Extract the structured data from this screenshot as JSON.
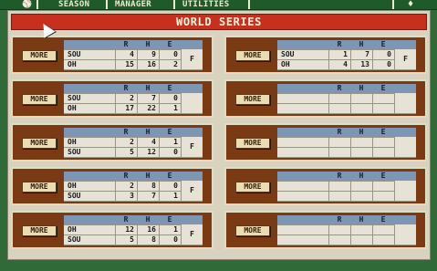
{
  "menubar": {
    "items": [
      "SEASON",
      "MANAGER",
      "UTILITIES"
    ]
  },
  "title": "WORLD SERIES",
  "more_label": "MORE",
  "headers": {
    "r": "R",
    "h": "H",
    "e": "E"
  },
  "games": [
    {
      "away": {
        "team": "SOU",
        "r": "4",
        "h": "9",
        "e": "0"
      },
      "home": {
        "team": "OH",
        "r": "15",
        "h": "16",
        "e": "2"
      },
      "status": "F"
    },
    {
      "away": {
        "team": "SOU",
        "r": "2",
        "h": "7",
        "e": "0"
      },
      "home": {
        "team": "OH",
        "r": "17",
        "h": "22",
        "e": "1"
      },
      "status": ""
    },
    {
      "away": {
        "team": "OH",
        "r": "2",
        "h": "4",
        "e": "1"
      },
      "home": {
        "team": "SOU",
        "r": "5",
        "h": "12",
        "e": "0"
      },
      "status": "F"
    },
    {
      "away": {
        "team": "OH",
        "r": "2",
        "h": "8",
        "e": "0"
      },
      "home": {
        "team": "SOU",
        "r": "3",
        "h": "7",
        "e": "1"
      },
      "status": "F"
    },
    {
      "away": {
        "team": "OH",
        "r": "12",
        "h": "16",
        "e": "1"
      },
      "home": {
        "team": "SOU",
        "r": "5",
        "h": "8",
        "e": "0"
      },
      "status": "F"
    },
    {
      "away": {
        "team": "SOU",
        "r": "1",
        "h": "7",
        "e": "0"
      },
      "home": {
        "team": "OH",
        "r": "4",
        "h": "13",
        "e": "0"
      },
      "status": "F"
    },
    {
      "away": {
        "team": "",
        "r": "",
        "h": "",
        "e": ""
      },
      "home": {
        "team": "",
        "r": "",
        "h": "",
        "e": ""
      },
      "status": ""
    },
    {
      "away": {
        "team": "",
        "r": "",
        "h": "",
        "e": ""
      },
      "home": {
        "team": "",
        "r": "",
        "h": "",
        "e": ""
      },
      "status": ""
    },
    {
      "away": {
        "team": "",
        "r": "",
        "h": "",
        "e": ""
      },
      "home": {
        "team": "",
        "r": "",
        "h": "",
        "e": ""
      },
      "status": ""
    },
    {
      "away": {
        "team": "",
        "r": "",
        "h": "",
        "e": ""
      },
      "home": {
        "team": "",
        "r": "",
        "h": "",
        "e": ""
      },
      "status": ""
    }
  ],
  "colors": {
    "background": "#2f6a38",
    "banner": "#c8301e",
    "card": "#7a3a14",
    "header": "#7c96b4"
  }
}
